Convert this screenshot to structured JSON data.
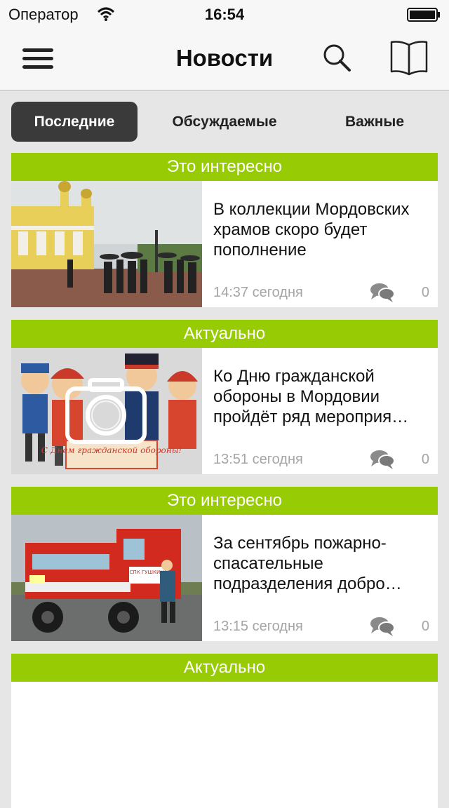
{
  "status": {
    "carrier": "Оператор",
    "time": "16:54"
  },
  "nav": {
    "title": "Новости"
  },
  "tabs": [
    {
      "label": "Последние",
      "active": true
    },
    {
      "label": "Обсуждаемые",
      "active": false
    },
    {
      "label": "Важные",
      "active": false
    }
  ],
  "articles": [
    {
      "category": "Это интересно",
      "title": "В коллекции Мордовских храмов скоро будет пополнение",
      "time": "14:37 сегодня",
      "comments": "0"
    },
    {
      "category": "Актуально",
      "title": "Ко Дню гражданской обороны в Мордовии пройдёт ряд мероприя…",
      "time": "13:51 сегодня",
      "comments": "0",
      "image_caption": "С Днем гражданской обороны!"
    },
    {
      "category": "Это интересно",
      "title": "За сентябрь пожарно-спасательные подразделения добро…",
      "time": "13:15 сегодня",
      "comments": "0",
      "image_caption": "ДПД СПК ГУШКИНСКИЙ"
    },
    {
      "category": "Актуально"
    }
  ],
  "colors": {
    "accent": "#97cc04",
    "tab_active": "#3a3a3a",
    "meta_text": "#a5a5a5"
  }
}
